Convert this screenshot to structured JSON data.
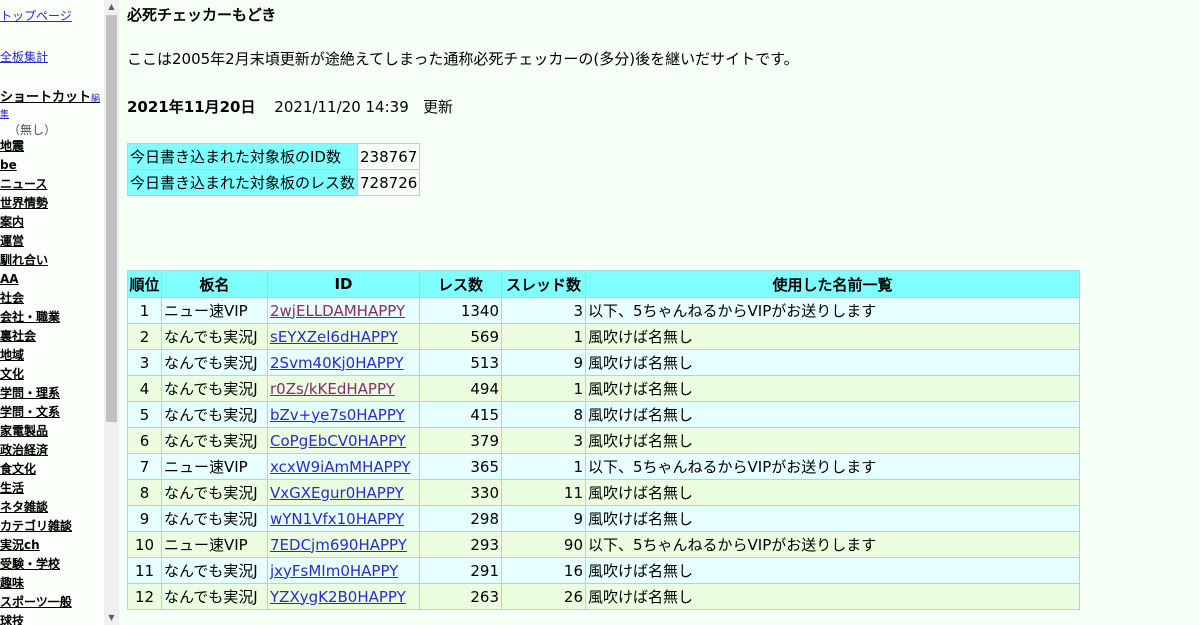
{
  "sidebar": {
    "top_link": "トップページ",
    "all_link": "全板集計",
    "shortcut_label": "ショートカット",
    "edit_label": "編",
    "edit_label2": "集",
    "none_label": "（無し）",
    "boards": [
      "地震",
      "be",
      "ニュース",
      "世界情勢",
      "案内",
      "運営",
      "馴れ合い",
      "AA",
      "社会",
      "会社・職業",
      "裏社会",
      "地域",
      "文化",
      "学問・理系",
      "学問・文系",
      "家電製品",
      "政治経済",
      "食文化",
      "生活",
      "ネタ雑談",
      "カテゴリ雑談",
      "実況ch",
      "受験・学校",
      "趣味",
      "スポーツ一般",
      "球技"
    ]
  },
  "main": {
    "title": "必死チェッカーもどき",
    "description": "ここは2005年2月末頃更新が途絶えてしまった通称必死チェッカーの(多分)後を継いだサイトです。",
    "date_bold": "2021年11月20日",
    "updated_at": "2021/11/20 14:39",
    "updated_suffix": "更新"
  },
  "stats": [
    {
      "label": "今日書き込まれた対象板のID数",
      "value": "238767"
    },
    {
      "label": "今日書き込まれた対象板のレス数",
      "value": "728726"
    }
  ],
  "ranking": {
    "headers": {
      "rank": "順位",
      "board": "板名",
      "id": "ID",
      "res": "レス数",
      "threads": "スレッド数",
      "names": "使用した名前一覧"
    },
    "rows": [
      {
        "rank": "1",
        "board": "ニュー速VIP",
        "id": "2wjELLDAMHAPPY",
        "res": "1340",
        "threads": "3",
        "names": "以下、5ちゃんねるからVIPがお送りします"
      },
      {
        "rank": "2",
        "board": "なんでも実況J",
        "id": "sEYXZel6dHAPPY",
        "res": "569",
        "threads": "1",
        "names": "風吹けば名無し"
      },
      {
        "rank": "3",
        "board": "なんでも実況J",
        "id": "2Svm40Kj0HAPPY",
        "res": "513",
        "threads": "9",
        "names": "風吹けば名無し"
      },
      {
        "rank": "4",
        "board": "なんでも実況J",
        "id": "r0Zs/kKEdHAPPY",
        "res": "494",
        "threads": "1",
        "names": "風吹けば名無し"
      },
      {
        "rank": "5",
        "board": "なんでも実況J",
        "id": "bZv+ye7s0HAPPY",
        "res": "415",
        "threads": "8",
        "names": "風吹けば名無し"
      },
      {
        "rank": "6",
        "board": "なんでも実況J",
        "id": "CoPgEbCV0HAPPY",
        "res": "379",
        "threads": "3",
        "names": "風吹けば名無し"
      },
      {
        "rank": "7",
        "board": "ニュー速VIP",
        "id": "xcxW9iAmMHAPPY",
        "res": "365",
        "threads": "1",
        "names": "以下、5ちゃんねるからVIPがお送りします"
      },
      {
        "rank": "8",
        "board": "なんでも実況J",
        "id": "VxGXEgur0HAPPY",
        "res": "330",
        "threads": "11",
        "names": "風吹けば名無し"
      },
      {
        "rank": "9",
        "board": "なんでも実況J",
        "id": "wYN1Vfx10HAPPY",
        "res": "298",
        "threads": "9",
        "names": "風吹けば名無し"
      },
      {
        "rank": "10",
        "board": "ニュー速VIP",
        "id": "7EDCjm690HAPPY",
        "res": "293",
        "threads": "90",
        "names": "以下、5ちゃんねるからVIPがお送りします"
      },
      {
        "rank": "11",
        "board": "なんでも実況J",
        "id": "jxyFsMIm0HAPPY",
        "res": "291",
        "threads": "16",
        "names": "風吹けば名無し"
      },
      {
        "rank": "12",
        "board": "なんでも実況J",
        "id": "YZXygK2B0HAPPY",
        "res": "263",
        "threads": "26",
        "names": "風吹けば名無し"
      }
    ]
  },
  "icons": {
    "scroll_up": "scroll-up-arrow-icon",
    "scroll_down": "scroll-down-arrow-icon"
  }
}
